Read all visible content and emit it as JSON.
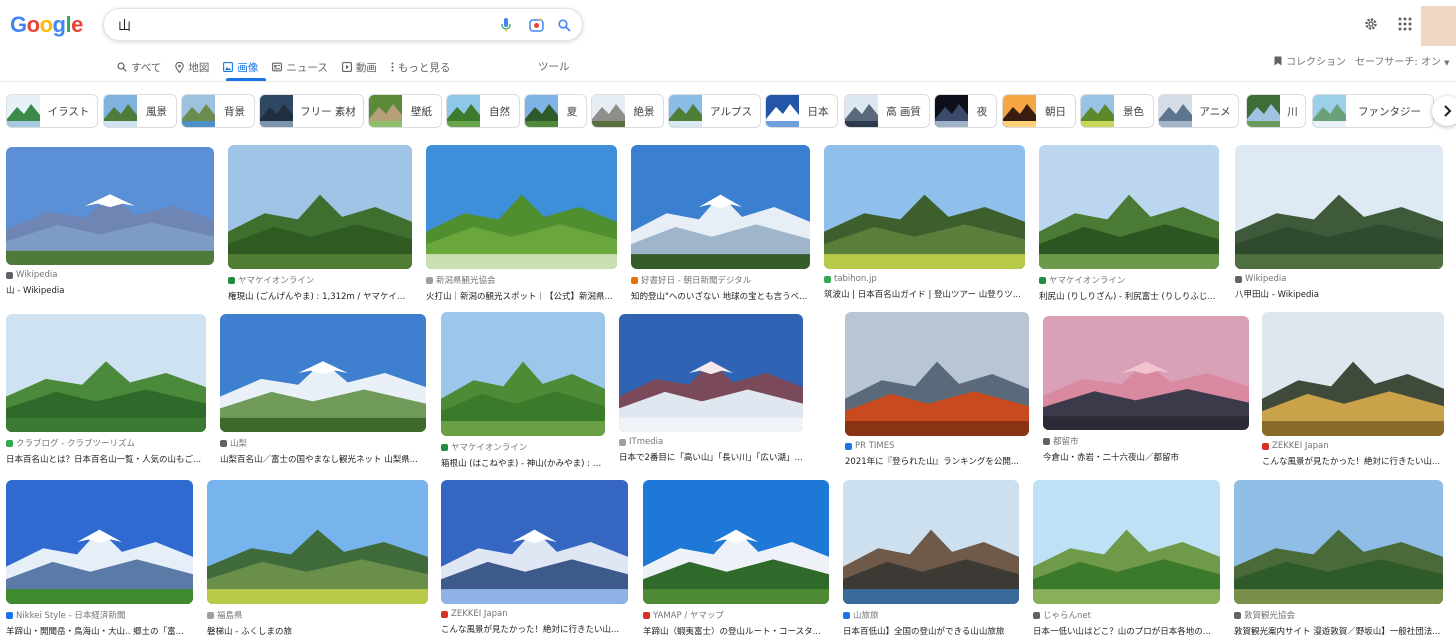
{
  "search": {
    "query": "山"
  },
  "tabs": [
    {
      "label": "すべて",
      "icon": "search-icon"
    },
    {
      "label": "地図",
      "icon": "map-pin-icon"
    },
    {
      "label": "画像",
      "icon": "image-icon"
    },
    {
      "label": "ニュース",
      "icon": "news-icon"
    },
    {
      "label": "動画",
      "icon": "video-icon"
    },
    {
      "label": "もっと見る",
      "icon": "more-dots-icon"
    }
  ],
  "tools_label": "ツール",
  "collection_label": "コレクション",
  "safesearch_label": "セーフサーチ: オン",
  "colors": {
    "accent": "#1a73e8",
    "g_blue": "#4285f4",
    "g_red": "#ea4335",
    "g_yellow": "#fbbc05",
    "g_green": "#34a853"
  },
  "chips": [
    "イラスト",
    "風景",
    "背景",
    "フリー 素材",
    "壁紙",
    "自然",
    "夏",
    "絶景",
    "アルプス",
    "日本",
    "高 画質",
    "夜",
    "朝日",
    "景色",
    "アニメ",
    "川",
    "ファンタジー"
  ],
  "results": [
    {
      "source": "Wikipedia",
      "title": "山 - Wikipedia"
    },
    {
      "source": "ヤマケイオンライン",
      "title": "権現山 (ごんげんやま) : 1,312m / ヤマケイオ..."
    },
    {
      "source": "新潟県観光協会",
      "title": "火打山｜新潟の観光スポット｜【公式】新潟県..."
    },
    {
      "source": "好書好日 - 朝日新聞デジタル",
      "title": "知的登山\"へのいざない 地球の宝とも言うべ..."
    },
    {
      "source": "tabihon.jp",
      "title": "筑波山 | 日本百名山ガイド | 登山ツアー 山登りツ..."
    },
    {
      "source": "ヤマケイオンライン",
      "title": "利尻山 (りしりざん) - 利尻富士 (りしりふじ..."
    },
    {
      "source": "Wikipedia",
      "title": "八甲田山 - Wikipedia"
    },
    {
      "source": "クラブログ - クラブツーリズム",
      "title": "日本百名山とは？日本百名山一覧・人気の山もご..."
    },
    {
      "source": "山梨",
      "title": "山梨百名山／富士の国やまなし観光ネット 山梨県..."
    },
    {
      "source": "ヤマケイオンライン",
      "title": "箱根山 (はこねやま) - 神山(かみやま) : 1..."
    },
    {
      "source": "ITmedia",
      "title": "日本で2番目に「高い山」「長い川」「広い湖」は？..."
    },
    {
      "source": "PR TIMES",
      "title": "2021年に『登られた山』ランキングを公開..."
    },
    {
      "source": "都留市",
      "title": "今倉山・赤岩・二十六夜山／都留市"
    },
    {
      "source": "ZEKKEI Japan",
      "title": "こんな風景が見たかった！絶対に行きたい山..."
    },
    {
      "source": "Nikkei Style - 日本経済新聞",
      "title": "羊蹄山・開聞岳・鳥海山・大山.. 郷土の「富..."
    },
    {
      "source": "福島県",
      "title": "磐梯山 - ふくしまの旅"
    },
    {
      "source": "ZEKKEI Japan",
      "title": "こんな風景が見たかった！絶対に行きたい山..."
    },
    {
      "source": "YAMAP / ヤマップ",
      "title": "羊蹄山（蝦夷富士）の登山ルート・コースタ..."
    },
    {
      "source": "山旅旅",
      "title": "日本百低山】全国の登山ができる山山旅旅"
    },
    {
      "source": "じゃらんnet",
      "title": "日本一低い山はどこ？山のプロが日本各地の..."
    },
    {
      "source": "敦賀観光協会",
      "title": "敦賀観光案内サイト 漫遊敦賀／野坂山】一般社団法..."
    }
  ]
}
